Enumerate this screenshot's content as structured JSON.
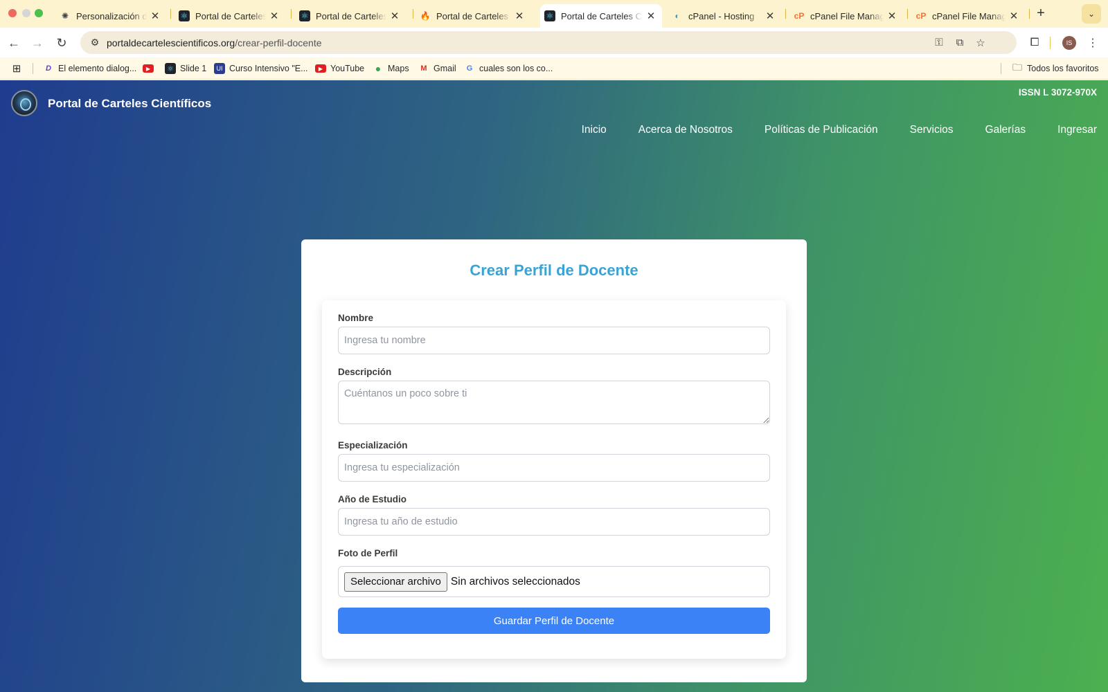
{
  "browser": {
    "tabs": [
      {
        "title": "Personalización de l",
        "icon": "openai-icon",
        "active": false
      },
      {
        "title": "Portal de Carteles C",
        "icon": "react-icon",
        "active": false
      },
      {
        "title": "Portal de Carteles C",
        "icon": "react-icon",
        "active": false
      },
      {
        "title": "Portal de Carteles C",
        "icon": "firebase-icon",
        "active": false
      },
      {
        "title": "Portal de Carteles C",
        "icon": "react-icon",
        "active": true
      },
      {
        "title": "cPanel - Hosting",
        "icon": "hosting-icon",
        "active": false
      },
      {
        "title": "cPanel File Manager",
        "icon": "cpanel-icon",
        "active": false
      },
      {
        "title": "cPanel File Manager",
        "icon": "cpanel-icon",
        "active": false
      }
    ],
    "url_domain": "portaldecartelescientificos.org",
    "url_path": "/crear-perfil-docente",
    "avatar_initials": "IS",
    "bookmarks": [
      {
        "label": "El elemento dialog...",
        "icon": "d-icon"
      },
      {
        "label": "",
        "icon": "youtube-icon"
      },
      {
        "label": "Slide 1",
        "icon": "react-icon"
      },
      {
        "label": "Curso Intensivo \"E...",
        "icon": "course-icon"
      },
      {
        "label": "YouTube",
        "icon": "youtube-icon"
      },
      {
        "label": "Maps",
        "icon": "maps-pin-icon"
      },
      {
        "label": "Gmail",
        "icon": "gmail-icon"
      },
      {
        "label": "cuales son los co...",
        "icon": "google-icon"
      }
    ],
    "all_bookmarks": "Todos los favoritos"
  },
  "site": {
    "title": "Portal de Carteles Científicos",
    "issn": "ISSN L 3072-970X",
    "nav": [
      "Inicio",
      "Acerca de Nosotros",
      "Políticas de Publicación",
      "Servicios",
      "Galerías",
      "Ingresar"
    ]
  },
  "form": {
    "title": "Crear Perfil de Docente",
    "nombre_label": "Nombre",
    "nombre_placeholder": "Ingresa tu nombre",
    "descripcion_label": "Descripción",
    "descripcion_placeholder": "Cuéntanos un poco sobre ti",
    "especializacion_label": "Especialización",
    "especializacion_placeholder": "Ingresa tu especialización",
    "anio_label": "Año de Estudio",
    "anio_placeholder": "Ingresa tu año de estudio",
    "foto_label": "Foto de Perfil",
    "file_button": "Seleccionar archivo",
    "file_status": "Sin archivos seleccionados",
    "submit": "Guardar Perfil de Docente"
  },
  "colors": {
    "title_blue": "#3aa3d4",
    "button_blue": "#3b82f6",
    "gradient_start": "#1f3c8e",
    "gradient_end": "#4cb04f"
  }
}
